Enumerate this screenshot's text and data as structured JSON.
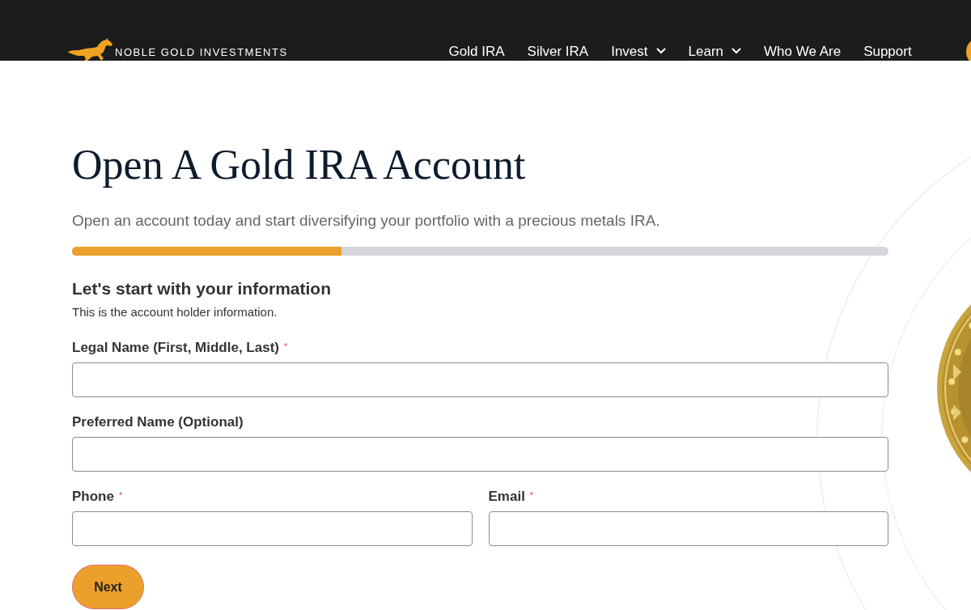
{
  "header": {
    "logo_text": "NOBLE GOLD INVESTMENTS",
    "nav": [
      {
        "label": "Gold IRA",
        "has_menu": false
      },
      {
        "label": "Silver IRA",
        "has_menu": false
      },
      {
        "label": "Invest",
        "has_menu": true
      },
      {
        "label": "Learn",
        "has_menu": true
      },
      {
        "label": "Who We Are",
        "has_menu": false
      },
      {
        "label": "Support",
        "has_menu": false
      }
    ]
  },
  "title": "Open A Gold IRA Account",
  "subtitle": "Open an account today and start diversifying your portfolio with a precious metals IRA.",
  "progress": {
    "level": 0.33
  },
  "section": {
    "heading": "Let's start with your information",
    "note": "This is the account holder information."
  },
  "fields": [
    {
      "label": "Legal Name (First, Middle, Last)",
      "marker": "*",
      "kind": "full"
    },
    {
      "label": "Preferred Name (Optional)",
      "kind": "full"
    },
    {
      "label": "Phone",
      "marker": "*",
      "kind": "half"
    },
    {
      "label": "Email",
      "marker": "*",
      "kind": "half"
    }
  ],
  "button": "Next"
}
